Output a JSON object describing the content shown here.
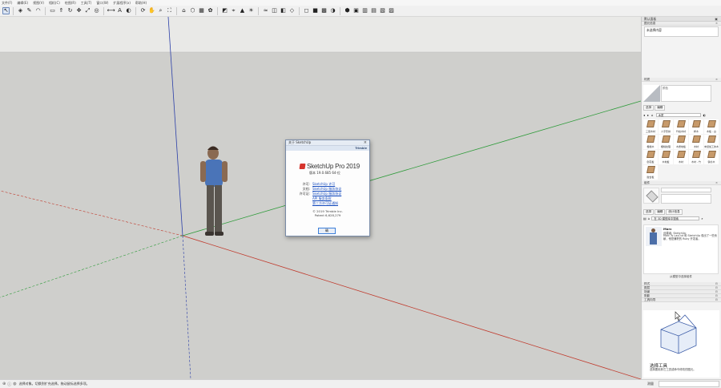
{
  "menu": [
    "文件(F)",
    "编辑(E)",
    "视图(V)",
    "相机(C)",
    "绘图(R)",
    "工具(T)",
    "窗口(W)",
    "扩展程序(x)",
    "帮助(H)"
  ],
  "toolbar": {
    "icons": [
      "select-icon",
      "eraser-icon",
      "pencil-icon",
      "arc-icon",
      "rectangle-icon",
      "push-pull-icon",
      "rotate-icon",
      "move-icon",
      "scale-icon",
      "offset-icon",
      "tape-measure-icon",
      "text-icon",
      "paint-bucket-icon",
      "orbit-icon",
      "pan-icon",
      "zoom-icon",
      "zoom-extents-icon",
      "warehouse-icon",
      "extension-warehouse-icon",
      "layout-icon",
      "style-builder-icon",
      "section-plane-icon",
      "add-location-icon",
      "terrain-icon",
      "shadows-icon",
      "fog-icon",
      "x-ray-icon",
      "back-edges-icon",
      "wireframe-icon",
      "hidden-line-icon",
      "shaded-icon",
      "textured-icon",
      "monochrome-icon",
      "iso-view-icon",
      "top-view-icon",
      "front-view-icon",
      "right-view-icon",
      "back-view-icon",
      "left-view-icon"
    ]
  },
  "about": {
    "title": "关于 SketchUp",
    "brand": "Trimble",
    "product": "SketchUp Pro 2019",
    "version": "版本 19.0.685 64-位",
    "rows": [
      {
        "label": "许可:",
        "value": "SketchUp 许可"
      },
      {
        "label": "文档:",
        "value": "SketchUp 服务协议"
      },
      {
        "label": "许可证:",
        "value": "SketchUp 服务协议"
      },
      {
        "label": "",
        "value": "API 服务条款"
      },
      {
        "label": "",
        "value": "第三方许可证通知"
      }
    ],
    "copyright": "© 2019 Trimble Inc.",
    "patent": "Patent 6,628,279",
    "ok": "确"
  },
  "tray": {
    "title": "默认面板",
    "entity_info": {
      "title": "图元信息",
      "text": "未选择内容"
    },
    "materials": {
      "title": "材质",
      "name_placeholder": "颜色",
      "tabs": [
        "选择",
        "编辑"
      ],
      "dropdown": "木质",
      "swatches": [
        "三层木材",
        "人字形拼",
        "竹纹木材",
        "桦木",
        "木板 - 白",
        "樱桃木",
        "樱桃纹理",
        "木质地板",
        "木材",
        "未经加工的木材",
        "刨花板",
        "木地板",
        "木材",
        "木材 - 竹",
        "铁杉木",
        "胶合板"
      ]
    },
    "components": {
      "title": "组件",
      "tabs": [
        "选择",
        "编辑",
        "统计信息"
      ],
      "search": "在 3D 模型库中搜索",
      "item_title": "Marc",
      "item_by": "创建者: SketchUp",
      "item_desc": "Marc 为 LayOut 和 SketchUp 做出了一些贡献，他是兼职的 Ruby 开发者。",
      "footer": "从模型中选择组件"
    },
    "collapsed": [
      "样式",
      "图层",
      "场景",
      "阴影"
    ],
    "instructor": {
      "title": "工具向导",
      "heading": "选择工具",
      "desc": "选择要用其它工具或命令修改的图元。"
    }
  },
  "status": {
    "text": "选择对象。切换到扩充选择。拖动鼠标选择多项。",
    "measure_label": "测量"
  },
  "colors": {
    "x_axis": "#c0392b",
    "y_axis": "#2e9b3a",
    "z_axis": "#2b3fa8",
    "sky": "#e8e8e6",
    "ground": "#cfcfcc"
  }
}
